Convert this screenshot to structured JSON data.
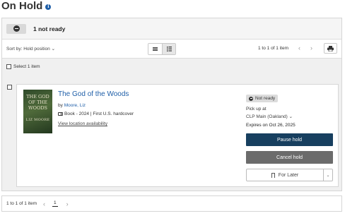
{
  "page": {
    "title": "On Hold",
    "info_icon": "info-icon"
  },
  "status_group": {
    "label": "1 not ready",
    "toggle_icon": "minus-circle-icon"
  },
  "toolbar": {
    "sort_label": "Sort by: Hold position",
    "sort_caret": "⌄",
    "view_modes": [
      "list-compact-icon",
      "list-detail-icon"
    ],
    "active_view": "list-detail-icon",
    "count_text": "1 to 1 of 1 item",
    "prev": "‹",
    "next": "›",
    "print_icon": "print-icon"
  },
  "select_all": {
    "label": "Select 1 item"
  },
  "item": {
    "cover": {
      "title_lines": [
        "THE GOD",
        "OF THE",
        "WOODS"
      ],
      "author": "LIZ MOORE"
    },
    "title": "The God of the Woods",
    "by_prefix": "by",
    "author": "Moore, Liz",
    "format": "Book - 2024 | First U.S. hardcover",
    "location_link": "View location availability",
    "status": "Not ready",
    "pickup_label": "Pick up at",
    "pickup_location": "CLP Main (Oakland)",
    "pickup_caret": "⌄",
    "expires": "Expires on Oct 26, 2025",
    "pause_label": "Pause hold",
    "cancel_label": "Cancel hold",
    "for_later_label": "For Later",
    "for_later_caret": "⌄"
  },
  "footer": {
    "count_text": "1 to 1 of 1 item",
    "prev": "‹",
    "current_page": "1",
    "next": "›"
  },
  "colors": {
    "link": "#1f5fa8",
    "pause_button": "#173f5f",
    "cancel_button": "#6b6b6b"
  }
}
